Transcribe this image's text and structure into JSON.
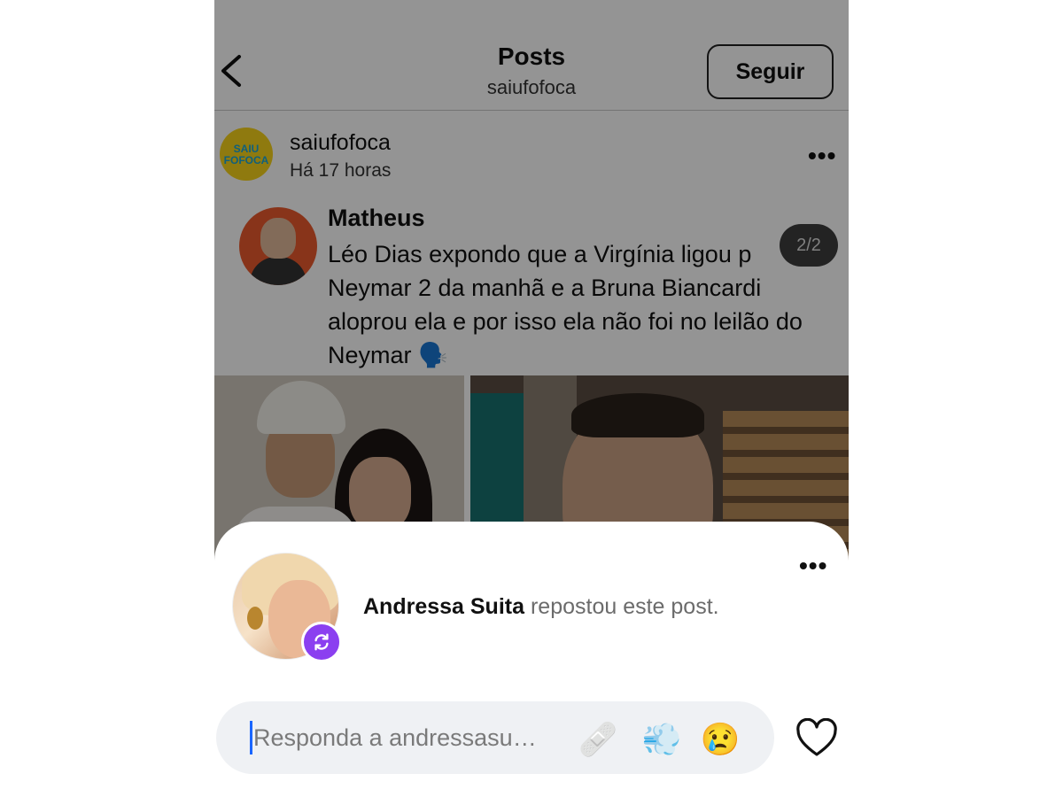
{
  "header": {
    "title": "Posts",
    "subtitle": "saiufofoca",
    "follow_label": "Seguir"
  },
  "post": {
    "username": "saiufofoca",
    "time": "Há 17 horas",
    "logo_line1": "SAIU",
    "logo_line2": "FOFOCA",
    "more_label": "•••",
    "quote": {
      "author": "Matheus",
      "text": "Léo Dias expondo que a Virgínia ligou p Neymar 2 da manhã e a Bruna Biancardi aloprou ela e por isso ela não foi no leilão do Neymar 🗣️"
    },
    "pager": "2/2"
  },
  "sheet": {
    "more_label": "•••",
    "repost_user": "Andressa Suita",
    "repost_action": " repostou este post.",
    "reply": {
      "placeholder": "Responda a andressasu…",
      "emojis": [
        "🩹",
        "💨",
        "😢"
      ]
    }
  },
  "colors": {
    "repost_badge": "#8b3ff0",
    "caret": "#1a66ff",
    "reply_box_bg": "#eff1f4"
  },
  "icons": [
    "back-arrow-icon",
    "more-icon",
    "repost-icon",
    "heart-icon"
  ]
}
